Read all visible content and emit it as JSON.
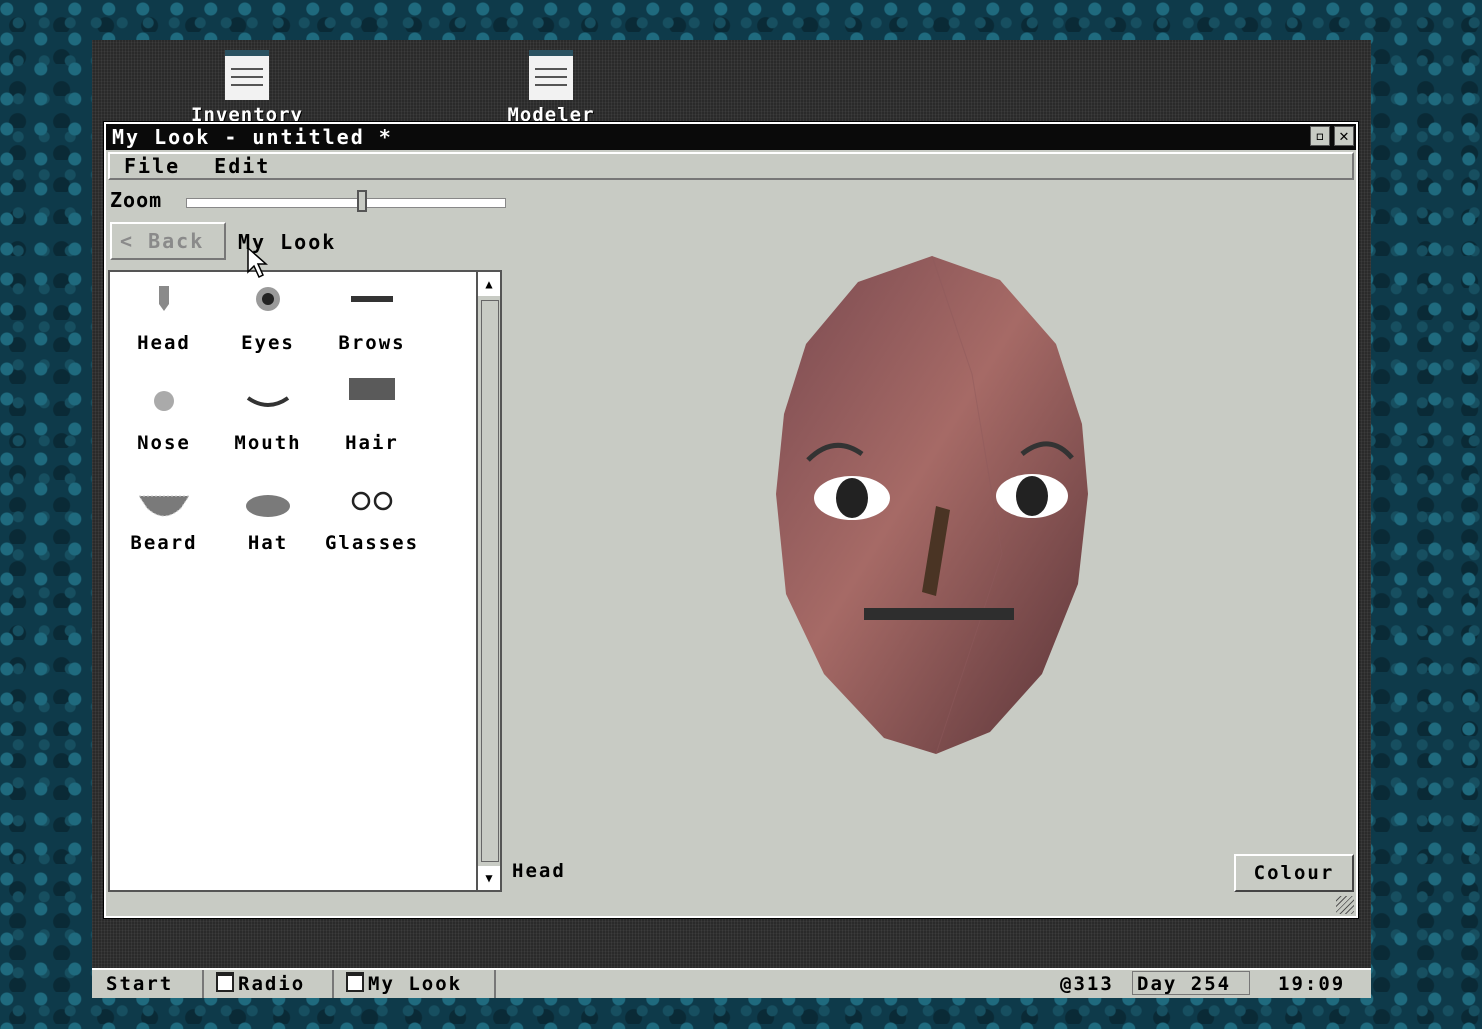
{
  "desktop": {
    "icons": [
      {
        "label": "Inventory"
      },
      {
        "label": "Modeler"
      }
    ]
  },
  "window": {
    "title": "My Look - untitled *",
    "menu": [
      "File",
      "Edit"
    ],
    "zoom_label": "Zoom",
    "zoom_level": 0.55,
    "back_label": "< Back",
    "breadcrumb": "My Look",
    "parts": [
      {
        "label": "Head",
        "icon": "head-icon"
      },
      {
        "label": "Eyes",
        "icon": "eye-icon"
      },
      {
        "label": "Brows",
        "icon": "brow-icon"
      },
      {
        "label": "Nose",
        "icon": "nose-icon"
      },
      {
        "label": "Mouth",
        "icon": "mouth-icon"
      },
      {
        "label": "Hair",
        "icon": "hair-icon"
      },
      {
        "label": "Beard",
        "icon": "beard-icon"
      },
      {
        "label": "Hat",
        "icon": "hat-icon"
      },
      {
        "label": "Glasses",
        "icon": "glasses-icon"
      }
    ],
    "selected_part": "Head",
    "colour_button": "Colour"
  },
  "taskbar": {
    "start": "Start",
    "tasks": [
      "Radio",
      "My Look"
    ],
    "credits": "@313",
    "day": "Day 254",
    "time": "19:09"
  },
  "colors": {
    "window_bg": "#c8cbc4",
    "titlebar": "#0a0a0a",
    "skin": "#9a5a5e"
  }
}
